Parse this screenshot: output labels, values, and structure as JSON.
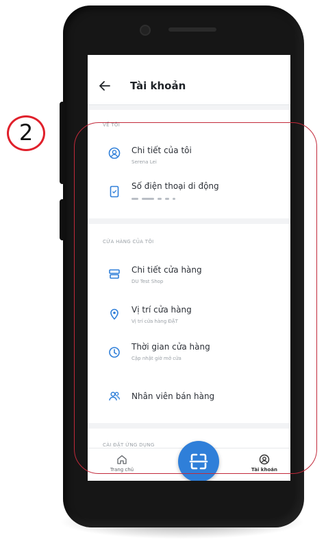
{
  "annotation": {
    "number": "2"
  },
  "header": {
    "title": "Tài khoản"
  },
  "sections": [
    {
      "label": "VỀ TÔI",
      "items": [
        {
          "title": "Chi tiết của tôi",
          "subtitle": "Serena Lei",
          "icon": "user-circle-icon"
        },
        {
          "title": "Số điện thoại di động",
          "subtitle": "",
          "icon": "mobile-phone-icon"
        }
      ]
    },
    {
      "label": "CỬA HÀNG CỦA TÔI",
      "items": [
        {
          "title": "Chi tiết cửa hàng",
          "subtitle": "DU Test Shop",
          "icon": "store-icon"
        },
        {
          "title": "Vị trí cửa hàng",
          "subtitle": "Vị trí cửa hàng ĐẶT",
          "icon": "location-pin-icon"
        },
        {
          "title": "Thời gian cửa hàng",
          "subtitle": "Cập nhật giờ mở cửa",
          "icon": "clock-icon"
        },
        {
          "title": "Nhân viên bán hàng",
          "subtitle": "",
          "icon": "staff-icon"
        }
      ]
    },
    {
      "label": "CÀI ĐẶT ỨNG DỤNG",
      "items": []
    }
  ],
  "bottom_nav": {
    "home_label": "Trang chủ",
    "account_label": "Tài khoản"
  },
  "colors": {
    "accent": "#2f7fd9",
    "annotation": "#e0202b",
    "highlight": "#c2293a"
  }
}
